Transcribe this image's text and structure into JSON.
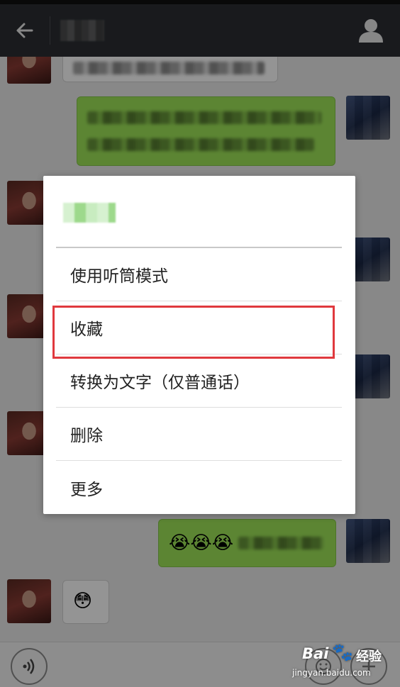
{
  "context_menu": {
    "header_title": "",
    "items": [
      {
        "label": "使用听筒模式"
      },
      {
        "label": "收藏"
      },
      {
        "label": "转换为文字（仅普通话）"
      },
      {
        "label": "删除"
      },
      {
        "label": "更多"
      }
    ],
    "highlighted_item": "收藏",
    "highlight_color": "#e0393e"
  },
  "chat": {
    "contact_name": "",
    "emoji_message": "😭😭😭",
    "received_emoji": "😳"
  },
  "colors": {
    "title_bar": "#2b2e33",
    "sent_bubble": "#9fe659",
    "received_bubble": "#ffffff"
  },
  "icons": {
    "back": "arrow-left",
    "profile": "person",
    "voice": "sound-waves",
    "emoji": "smiley",
    "plus": "plus"
  },
  "watermark": {
    "logo": "Bai",
    "suffix": "经验",
    "url": "jingyan.baidu.com"
  }
}
